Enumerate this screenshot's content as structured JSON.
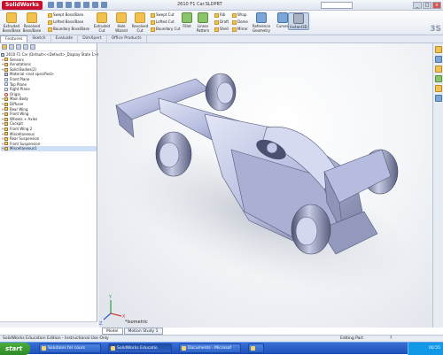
{
  "app": {
    "brand": "SolidWorks",
    "window_title": "2610 F1 Car.SLDPRT",
    "search_placeholder": "",
    "brand_watermark": "3S"
  },
  "ribbon": {
    "main_buttons": [
      {
        "label": "Extruded Boss/Base"
      },
      {
        "label": "Revolved Boss/Base"
      },
      {
        "label": "Extruded Cut"
      },
      {
        "label": "Hole Wizard"
      },
      {
        "label": "Revolved Cut"
      },
      {
        "label": "Fillet"
      },
      {
        "label": "Linear Pattern"
      },
      {
        "label": "Reference Geometry"
      },
      {
        "label": "Curves"
      },
      {
        "label": "Instant3D"
      }
    ],
    "small_buttons": [
      {
        "label": "Swept Boss/Base"
      },
      {
        "label": "Lofted Boss/Base"
      },
      {
        "label": "Boundary Boss/Base"
      },
      {
        "label": "Swept Cut"
      },
      {
        "label": "Lofted Cut"
      },
      {
        "label": "Boundary Cut"
      },
      {
        "label": "Rib"
      },
      {
        "label": "Draft"
      },
      {
        "label": "Shell"
      },
      {
        "label": "Wrap"
      },
      {
        "label": "Dome"
      },
      {
        "label": "Mirror"
      }
    ]
  },
  "command_tabs": [
    "Features",
    "Sketch",
    "Evaluate",
    "DimXpert",
    "Office Products"
  ],
  "feature_manager": {
    "tabs": [
      "Features"
    ],
    "root": "2610 F1 Car  (Default<<Default>_Display State 1>)",
    "items": [
      {
        "label": "Sensors",
        "type": "folder",
        "expand": "+"
      },
      {
        "label": "Annotations",
        "type": "folder",
        "expand": "+"
      },
      {
        "label": "Solid Bodies(2)",
        "type": "folder",
        "expand": "+"
      },
      {
        "label": "Material <not specified>",
        "type": "part",
        "expand": ""
      },
      {
        "label": "Front Plane",
        "type": "plane",
        "expand": ""
      },
      {
        "label": "Top Plane",
        "type": "plane",
        "expand": ""
      },
      {
        "label": "Right Plane",
        "type": "plane",
        "expand": ""
      },
      {
        "label": "Origin",
        "type": "origin",
        "expand": ""
      },
      {
        "label": "Main Body",
        "type": "folder",
        "expand": "+"
      },
      {
        "label": "Diffuser",
        "type": "folder",
        "expand": "+"
      },
      {
        "label": "Rear Wing",
        "type": "folder",
        "expand": "+"
      },
      {
        "label": "Front Wing",
        "type": "folder",
        "expand": "+"
      },
      {
        "label": "Wheels + Axles",
        "type": "folder",
        "expand": "+"
      },
      {
        "label": "Cockpit",
        "type": "folder",
        "expand": "+"
      },
      {
        "label": "Front Wing 2",
        "type": "folder",
        "expand": "+"
      },
      {
        "label": "Miscellaneous",
        "type": "folder",
        "expand": "+"
      },
      {
        "label": "Rear Suspension",
        "type": "folder",
        "expand": "+"
      },
      {
        "label": "Front Suspension",
        "type": "folder",
        "expand": "+"
      },
      {
        "label": "Miscellaneous1",
        "type": "folder",
        "expand": "+",
        "selected": true
      }
    ]
  },
  "viewport": {
    "view_label": "*Isometric",
    "triad": {
      "x": "X",
      "y": "Y",
      "z": "Z"
    }
  },
  "bottom_tabs": [
    "Model",
    "Motion Study 1"
  ],
  "status_bar": {
    "left": "SolidWorks Education Edition - Instructional Use Only",
    "right": "Editing Part",
    "help": "?"
  },
  "taskbar": {
    "start_label": "start",
    "items": [
      {
        "label": "Solutions for cours"
      },
      {
        "label": "SolidWorks Educatio"
      },
      {
        "label": "Documents - Microsof"
      },
      {
        "label": ""
      }
    ],
    "clock": "00:55"
  },
  "colors": {
    "brand_red": "#c8102e",
    "ribbon_bg": "#e6ebf3",
    "model_body": "#b8bfe0",
    "taskbar_blue": "#245edb",
    "start_green": "#3c9c2f"
  }
}
